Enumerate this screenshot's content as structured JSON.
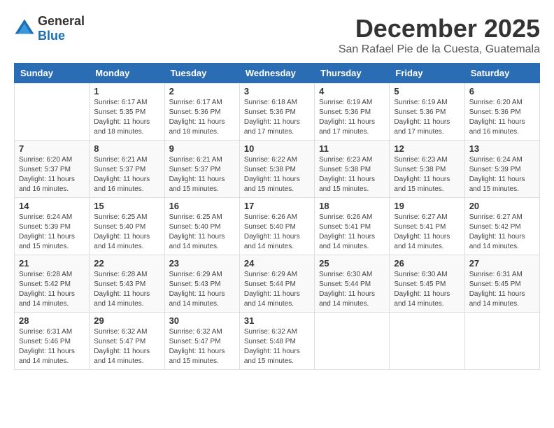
{
  "logo": {
    "general": "General",
    "blue": "Blue"
  },
  "title": "December 2025",
  "location": "San Rafael Pie de la Cuesta, Guatemala",
  "weekdays": [
    "Sunday",
    "Monday",
    "Tuesday",
    "Wednesday",
    "Thursday",
    "Friday",
    "Saturday"
  ],
  "weeks": [
    [
      {
        "day": "",
        "sunrise": "",
        "sunset": "",
        "daylight": ""
      },
      {
        "day": "1",
        "sunrise": "Sunrise: 6:17 AM",
        "sunset": "Sunset: 5:35 PM",
        "daylight": "Daylight: 11 hours and 18 minutes."
      },
      {
        "day": "2",
        "sunrise": "Sunrise: 6:17 AM",
        "sunset": "Sunset: 5:36 PM",
        "daylight": "Daylight: 11 hours and 18 minutes."
      },
      {
        "day": "3",
        "sunrise": "Sunrise: 6:18 AM",
        "sunset": "Sunset: 5:36 PM",
        "daylight": "Daylight: 11 hours and 17 minutes."
      },
      {
        "day": "4",
        "sunrise": "Sunrise: 6:19 AM",
        "sunset": "Sunset: 5:36 PM",
        "daylight": "Daylight: 11 hours and 17 minutes."
      },
      {
        "day": "5",
        "sunrise": "Sunrise: 6:19 AM",
        "sunset": "Sunset: 5:36 PM",
        "daylight": "Daylight: 11 hours and 17 minutes."
      },
      {
        "day": "6",
        "sunrise": "Sunrise: 6:20 AM",
        "sunset": "Sunset: 5:36 PM",
        "daylight": "Daylight: 11 hours and 16 minutes."
      }
    ],
    [
      {
        "day": "7",
        "sunrise": "Sunrise: 6:20 AM",
        "sunset": "Sunset: 5:37 PM",
        "daylight": "Daylight: 11 hours and 16 minutes."
      },
      {
        "day": "8",
        "sunrise": "Sunrise: 6:21 AM",
        "sunset": "Sunset: 5:37 PM",
        "daylight": "Daylight: 11 hours and 16 minutes."
      },
      {
        "day": "9",
        "sunrise": "Sunrise: 6:21 AM",
        "sunset": "Sunset: 5:37 PM",
        "daylight": "Daylight: 11 hours and 15 minutes."
      },
      {
        "day": "10",
        "sunrise": "Sunrise: 6:22 AM",
        "sunset": "Sunset: 5:38 PM",
        "daylight": "Daylight: 11 hours and 15 minutes."
      },
      {
        "day": "11",
        "sunrise": "Sunrise: 6:23 AM",
        "sunset": "Sunset: 5:38 PM",
        "daylight": "Daylight: 11 hours and 15 minutes."
      },
      {
        "day": "12",
        "sunrise": "Sunrise: 6:23 AM",
        "sunset": "Sunset: 5:38 PM",
        "daylight": "Daylight: 11 hours and 15 minutes."
      },
      {
        "day": "13",
        "sunrise": "Sunrise: 6:24 AM",
        "sunset": "Sunset: 5:39 PM",
        "daylight": "Daylight: 11 hours and 15 minutes."
      }
    ],
    [
      {
        "day": "14",
        "sunrise": "Sunrise: 6:24 AM",
        "sunset": "Sunset: 5:39 PM",
        "daylight": "Daylight: 11 hours and 15 minutes."
      },
      {
        "day": "15",
        "sunrise": "Sunrise: 6:25 AM",
        "sunset": "Sunset: 5:40 PM",
        "daylight": "Daylight: 11 hours and 14 minutes."
      },
      {
        "day": "16",
        "sunrise": "Sunrise: 6:25 AM",
        "sunset": "Sunset: 5:40 PM",
        "daylight": "Daylight: 11 hours and 14 minutes."
      },
      {
        "day": "17",
        "sunrise": "Sunrise: 6:26 AM",
        "sunset": "Sunset: 5:40 PM",
        "daylight": "Daylight: 11 hours and 14 minutes."
      },
      {
        "day": "18",
        "sunrise": "Sunrise: 6:26 AM",
        "sunset": "Sunset: 5:41 PM",
        "daylight": "Daylight: 11 hours and 14 minutes."
      },
      {
        "day": "19",
        "sunrise": "Sunrise: 6:27 AM",
        "sunset": "Sunset: 5:41 PM",
        "daylight": "Daylight: 11 hours and 14 minutes."
      },
      {
        "day": "20",
        "sunrise": "Sunrise: 6:27 AM",
        "sunset": "Sunset: 5:42 PM",
        "daylight": "Daylight: 11 hours and 14 minutes."
      }
    ],
    [
      {
        "day": "21",
        "sunrise": "Sunrise: 6:28 AM",
        "sunset": "Sunset: 5:42 PM",
        "daylight": "Daylight: 11 hours and 14 minutes."
      },
      {
        "day": "22",
        "sunrise": "Sunrise: 6:28 AM",
        "sunset": "Sunset: 5:43 PM",
        "daylight": "Daylight: 11 hours and 14 minutes."
      },
      {
        "day": "23",
        "sunrise": "Sunrise: 6:29 AM",
        "sunset": "Sunset: 5:43 PM",
        "daylight": "Daylight: 11 hours and 14 minutes."
      },
      {
        "day": "24",
        "sunrise": "Sunrise: 6:29 AM",
        "sunset": "Sunset: 5:44 PM",
        "daylight": "Daylight: 11 hours and 14 minutes."
      },
      {
        "day": "25",
        "sunrise": "Sunrise: 6:30 AM",
        "sunset": "Sunset: 5:44 PM",
        "daylight": "Daylight: 11 hours and 14 minutes."
      },
      {
        "day": "26",
        "sunrise": "Sunrise: 6:30 AM",
        "sunset": "Sunset: 5:45 PM",
        "daylight": "Daylight: 11 hours and 14 minutes."
      },
      {
        "day": "27",
        "sunrise": "Sunrise: 6:31 AM",
        "sunset": "Sunset: 5:45 PM",
        "daylight": "Daylight: 11 hours and 14 minutes."
      }
    ],
    [
      {
        "day": "28",
        "sunrise": "Sunrise: 6:31 AM",
        "sunset": "Sunset: 5:46 PM",
        "daylight": "Daylight: 11 hours and 14 minutes."
      },
      {
        "day": "29",
        "sunrise": "Sunrise: 6:32 AM",
        "sunset": "Sunset: 5:47 PM",
        "daylight": "Daylight: 11 hours and 14 minutes."
      },
      {
        "day": "30",
        "sunrise": "Sunrise: 6:32 AM",
        "sunset": "Sunset: 5:47 PM",
        "daylight": "Daylight: 11 hours and 15 minutes."
      },
      {
        "day": "31",
        "sunrise": "Sunrise: 6:32 AM",
        "sunset": "Sunset: 5:48 PM",
        "daylight": "Daylight: 11 hours and 15 minutes."
      },
      {
        "day": "",
        "sunrise": "",
        "sunset": "",
        "daylight": ""
      },
      {
        "day": "",
        "sunrise": "",
        "sunset": "",
        "daylight": ""
      },
      {
        "day": "",
        "sunrise": "",
        "sunset": "",
        "daylight": ""
      }
    ]
  ]
}
